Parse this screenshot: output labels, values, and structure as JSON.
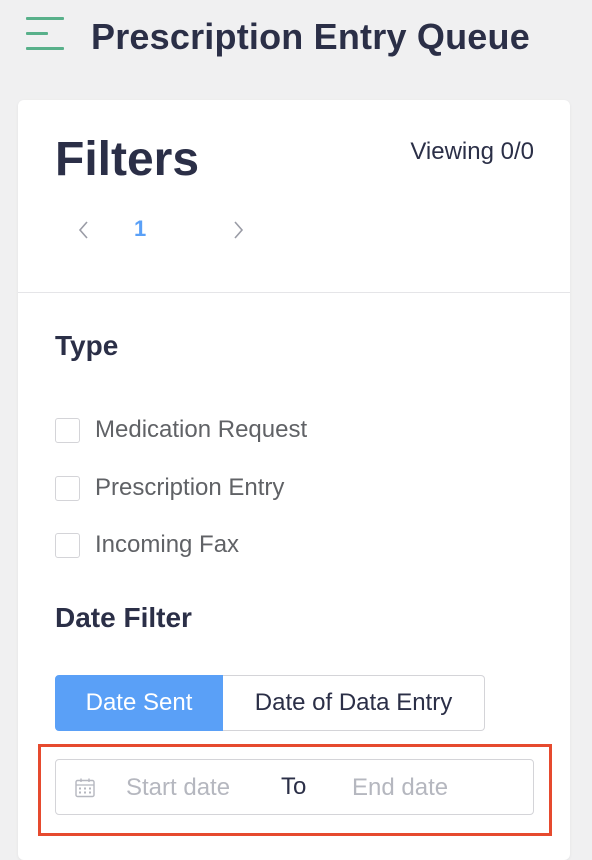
{
  "header": {
    "title": "Prescription Entry Queue"
  },
  "filters": {
    "title": "Filters",
    "viewing": "Viewing 0/0",
    "pagination": {
      "current_page": "1"
    }
  },
  "type_section": {
    "title": "Type",
    "options": [
      {
        "label": "Medication Request",
        "checked": false
      },
      {
        "label": "Prescription Entry",
        "checked": false
      },
      {
        "label": "Incoming Fax",
        "checked": false
      }
    ]
  },
  "date_section": {
    "title": "Date Filter",
    "tabs": [
      {
        "label": "Date Sent",
        "active": true
      },
      {
        "label": "Date of Data Entry",
        "active": false
      }
    ],
    "range": {
      "start_placeholder": "Start date",
      "separator": "To",
      "end_placeholder": "End date",
      "icon": "calendar-icon"
    }
  },
  "colors": {
    "accent_blue": "#5aa0f7",
    "menu_green": "#58b08a",
    "highlight_red": "#e64a2e",
    "title_navy": "#2b2f47"
  }
}
